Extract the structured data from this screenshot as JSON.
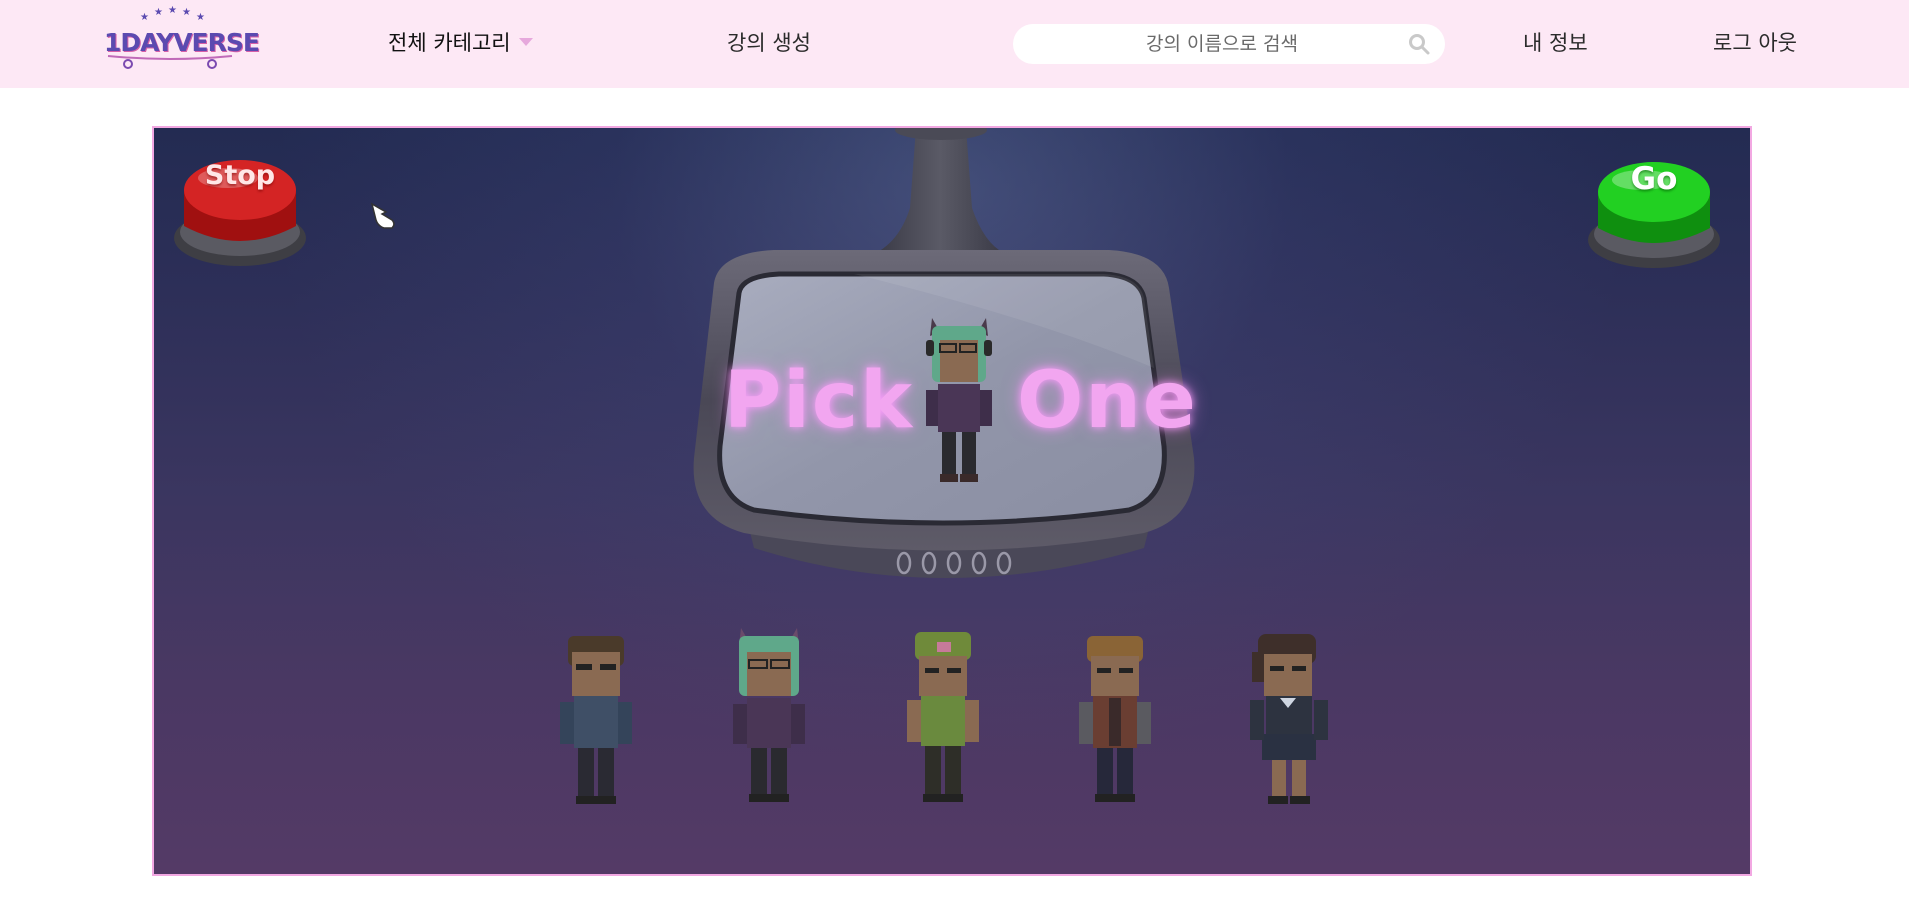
{
  "header": {
    "logo_text": "1DAYVERSE",
    "nav_category": "전체 카테고리",
    "nav_create": "강의 생성",
    "search_placeholder": "강의 이름으로 검색",
    "nav_myinfo": "내 정보",
    "nav_logout": "로그 아웃"
  },
  "game": {
    "title_left": "Pick",
    "title_right": "One",
    "stop_label": "Stop",
    "go_label": "Go",
    "mirror_dots": 5,
    "characters": [
      {
        "name": "character-1",
        "hair": "#4a3a2a",
        "shirt": "#3f4f66",
        "pants": "#2a2a33"
      },
      {
        "name": "character-2",
        "hair": "#5fa88a",
        "shirt": "#4a3656",
        "pants": "#2a2a2f"
      },
      {
        "name": "character-3",
        "hair": "#6f8a3a",
        "shirt": "#6a8a3e",
        "pants": "#2e2e28"
      },
      {
        "name": "character-4",
        "hair": "#8a6436",
        "shirt": "#6a3e32",
        "pants": "#26283a"
      },
      {
        "name": "character-5",
        "hair": "#3e2f2a",
        "shirt": "#2d3340",
        "pants": "#2a3142"
      }
    ]
  },
  "colors": {
    "header_bg": "#fde8f5",
    "accent_pink": "#f2a6f0",
    "stop_red": "#d02020",
    "go_green": "#22cc22"
  }
}
